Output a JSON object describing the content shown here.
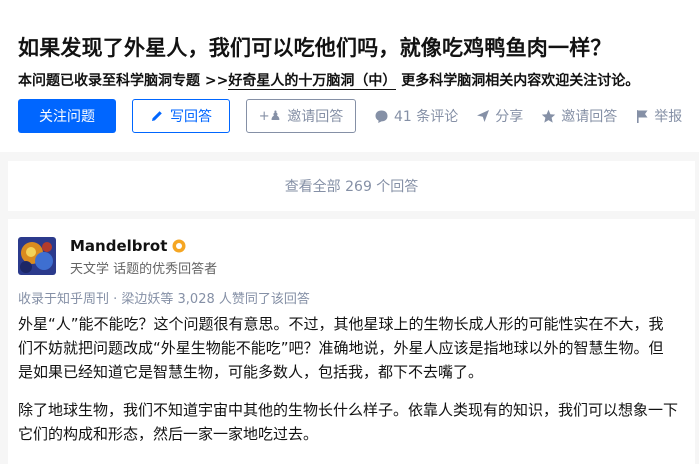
{
  "question": {
    "title": "如果发现了外星人，我们可以吃他们吗，就像吃鸡鸭鱼肉一样？",
    "desc_prefix": "本问题已收录至科学脑洞专题 >>",
    "desc_link": "好奇星人的十万脑洞（中）",
    "desc_suffix": "更多科学脑洞相关内容欢迎关注讨论。"
  },
  "actions": {
    "follow": "关注问题",
    "write": "写回答",
    "invite": "邀请回答",
    "comments": "41 条评论",
    "share": "分享",
    "invite_answer": "邀请回答",
    "report": "举报"
  },
  "view_all": "查看全部 269 个回答",
  "answer": {
    "author": "Mandelbrot",
    "bio": "天文学 话题的优秀回答者",
    "collected": "收录于知乎周刊 · 梁边妖等 3,028 人赞同了该回答",
    "paragraph1": "外星“人”能不能吃？这个问题很有意思。不过，其他星球上的生物长成人形的可能性实在不大，我们不妨就把问题改成“外星生物能不能吃”吧？准确地说，外星人应该是指地球以外的智慧生物。但是如果已经知道它是智慧生物，可能多数人，包括我，都下不去嘴了。",
    "paragraph2": "除了地球生物，我们不知道宇宙中其他的生物长什么样子。依靠人类现有的知识，我们可以想象一下它们的构成和形态，然后一家一家地吃过去。"
  },
  "colors": {
    "accent": "#0066ff",
    "muted": "#8590a6",
    "text": "#121212",
    "badge": "#f5a623"
  },
  "icons": [
    "pencil-icon",
    "plus-person-icon",
    "comment-icon",
    "share-icon",
    "star-icon",
    "flag-icon",
    "excellence-badge-icon"
  ]
}
